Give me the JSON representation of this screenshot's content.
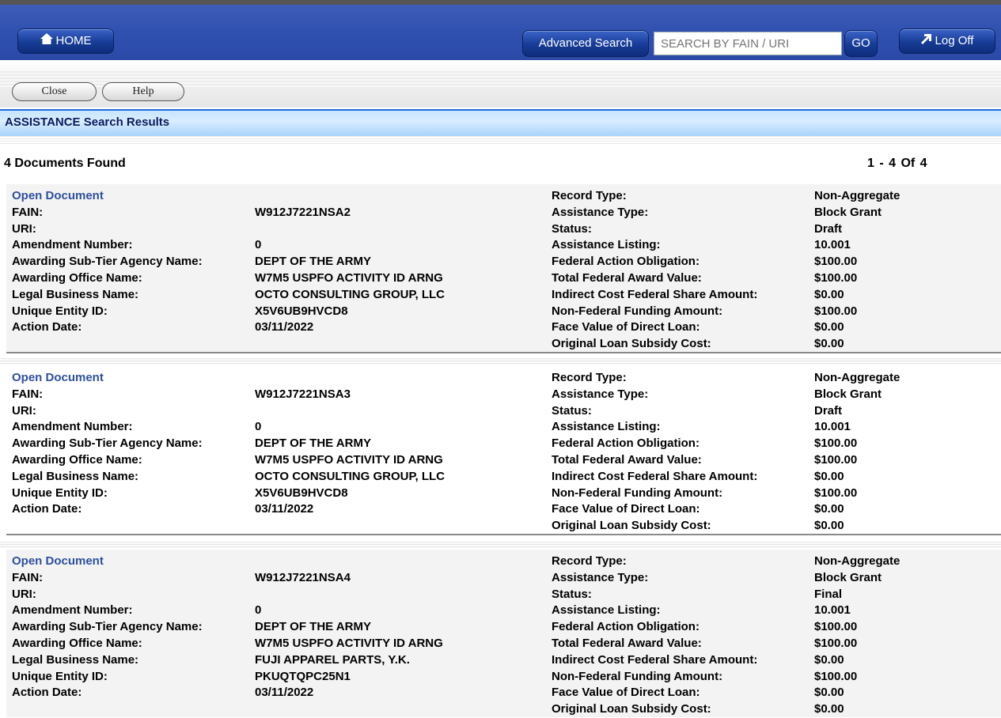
{
  "header": {
    "home_label": "HOME",
    "advanced_search_label": "Advanced Search",
    "search_placeholder": "SEARCH BY FAIN / URI",
    "go_label": "GO",
    "logoff_label": "Log Off"
  },
  "toolbar": {
    "close_label": "Close",
    "help_label": "Help"
  },
  "section_title": "ASSISTANCE Search Results",
  "results": {
    "count_text": "4 Documents Found",
    "pager_text": "1 - 4  Of 4"
  },
  "labels": {
    "open_document": "Open Document",
    "fain": "FAIN:",
    "uri": "URI:",
    "amendment_number": "Amendment Number:",
    "sub_tier": "Awarding Sub-Tier Agency Name:",
    "office": "Awarding Office Name:",
    "legal_name": "Legal Business Name:",
    "uei": "Unique Entity ID:",
    "action_date": "Action Date:",
    "record_type": "Record Type:",
    "assistance_type": "Assistance Type:",
    "status": "Status:",
    "assistance_listing": "Assistance Listing:",
    "obligation": "Federal Action Obligation:",
    "total_value": "Total Federal Award Value:",
    "indirect": "Indirect Cost Federal Share Amount:",
    "non_federal": "Non-Federal Funding Amount:",
    "face_value": "Face Value of Direct Loan:",
    "subsidy": "Original Loan Subsidy Cost:"
  },
  "records": [
    {
      "fain": "W912J7221NSA2",
      "uri": "",
      "amendment_number": "0",
      "sub_tier": "DEPT OF THE ARMY",
      "office": "W7M5 USPFO ACTIVITY ID ARNG",
      "legal_name": "OCTO CONSULTING GROUP, LLC",
      "uei": "X5V6UB9HVCD8",
      "action_date": "03/11/2022",
      "record_type": "Non-Aggregate",
      "assistance_type": "Block Grant",
      "status": "Draft",
      "assistance_listing": "10.001",
      "obligation": "$100.00",
      "total_value": "$100.00",
      "indirect": "$0.00",
      "non_federal": "$100.00",
      "face_value": "$0.00",
      "subsidy": "$0.00"
    },
    {
      "fain": "W912J7221NSA3",
      "uri": "",
      "amendment_number": "0",
      "sub_tier": "DEPT OF THE ARMY",
      "office": "W7M5 USPFO ACTIVITY ID ARNG",
      "legal_name": "OCTO CONSULTING GROUP, LLC",
      "uei": "X5V6UB9HVCD8",
      "action_date": "03/11/2022",
      "record_type": "Non-Aggregate",
      "assistance_type": "Block Grant",
      "status": "Draft",
      "assistance_listing": "10.001",
      "obligation": "$100.00",
      "total_value": "$100.00",
      "indirect": "$0.00",
      "non_federal": "$100.00",
      "face_value": "$0.00",
      "subsidy": "$0.00"
    },
    {
      "fain": "W912J7221NSA4",
      "uri": "",
      "amendment_number": "0",
      "sub_tier": "DEPT OF THE ARMY",
      "office": "W7M5 USPFO ACTIVITY ID ARNG",
      "legal_name": "FUJI APPAREL PARTS, Y.K.",
      "uei": "PKUQTQPC25N1",
      "action_date": "03/11/2022",
      "record_type": "Non-Aggregate",
      "assistance_type": "Block Grant",
      "status": "Final",
      "assistance_listing": "10.001",
      "obligation": "$100.00",
      "total_value": "$100.00",
      "indirect": "$0.00",
      "non_federal": "$100.00",
      "face_value": "$0.00",
      "subsidy": "$0.00"
    }
  ],
  "icons": {
    "home": "home-icon",
    "logoff": "external-arrow-icon"
  }
}
